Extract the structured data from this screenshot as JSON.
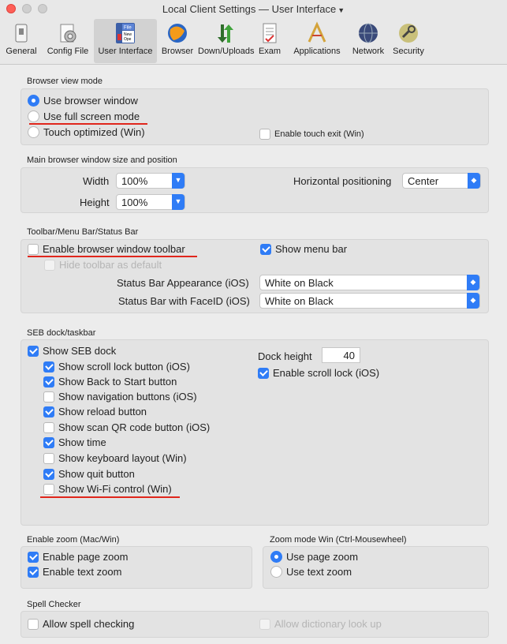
{
  "window": {
    "title": "Local Client Settings",
    "separator": "—",
    "section": "User Interface",
    "caret": "▼"
  },
  "toolbar": {
    "items": [
      {
        "label": "General",
        "icon": "general-icon"
      },
      {
        "label": "Config File",
        "icon": "config-file-icon"
      },
      {
        "label": "User Interface",
        "icon": "user-interface-icon",
        "selected": true
      },
      {
        "label": "Browser",
        "icon": "browser-icon"
      },
      {
        "label": "Down/Uploads",
        "icon": "down-uploads-icon"
      },
      {
        "label": "Exam",
        "icon": "exam-icon"
      },
      {
        "label": "Applications",
        "icon": "applications-icon"
      },
      {
        "label": "Network",
        "icon": "network-icon"
      },
      {
        "label": "Security",
        "icon": "security-icon"
      }
    ],
    "ui_icon_text": {
      "file": "File",
      "new": "New",
      "open": "Ope"
    }
  },
  "browser_view": {
    "title": "Browser view mode",
    "options": {
      "browser_window": "Use browser window",
      "full_screen": "Use full screen mode",
      "touch": "Touch optimized (Win)"
    },
    "selected": "browser_window",
    "touch_exit": "Enable touch exit (Win)"
  },
  "window_size": {
    "title": "Main browser window size and position",
    "width_label": "Width",
    "width_value": "100%",
    "height_label": "Height",
    "height_value": "100%",
    "hpos_label": "Horizontal positioning",
    "hpos_value": "Center"
  },
  "toolbar_menu": {
    "title": "Toolbar/Menu Bar/Status Bar",
    "enable_toolbar": "Enable browser window toolbar",
    "show_menu_bar": "Show menu bar",
    "hide_toolbar": "Hide toolbar as default",
    "status_bar_label": "Status Bar Appearance (iOS)",
    "status_bar_value": "White on Black",
    "faceid_label": "Status Bar with FaceID (iOS)",
    "faceid_value": "White on Black"
  },
  "dock": {
    "title": "SEB dock/taskbar",
    "show_dock": "Show SEB dock",
    "items": [
      {
        "label": "Show scroll lock button (iOS)",
        "checked": true
      },
      {
        "label": "Show Back to Start button",
        "checked": true
      },
      {
        "label": "Show navigation buttons (iOS)",
        "checked": false
      },
      {
        "label": "Show reload button",
        "checked": true
      },
      {
        "label": "Show scan QR code button (iOS)",
        "checked": false
      },
      {
        "label": "Show time",
        "checked": true
      },
      {
        "label": "Show keyboard layout (Win)",
        "checked": false
      },
      {
        "label": "Show quit button",
        "checked": true
      },
      {
        "label": "Show Wi-Fi control (Win)",
        "checked": false
      }
    ],
    "height_label": "Dock height",
    "height_value": "40",
    "scroll_lock": "Enable scroll lock (iOS)"
  },
  "zoom": {
    "title": "Enable zoom (Mac/Win)",
    "page_zoom": "Enable page zoom",
    "text_zoom": "Enable text zoom"
  },
  "zoom_mode": {
    "title": "Zoom mode Win (Ctrl-Mousewheel)",
    "page": "Use page zoom",
    "text": "Use text zoom"
  },
  "spell": {
    "title": "Spell Checker",
    "allow_spell": "Allow spell checking",
    "dictionary": "Allow dictionary look up"
  },
  "colors": {
    "accent": "#2f7cf6",
    "annotation": "#e0261c",
    "close": "#fe5f57"
  }
}
